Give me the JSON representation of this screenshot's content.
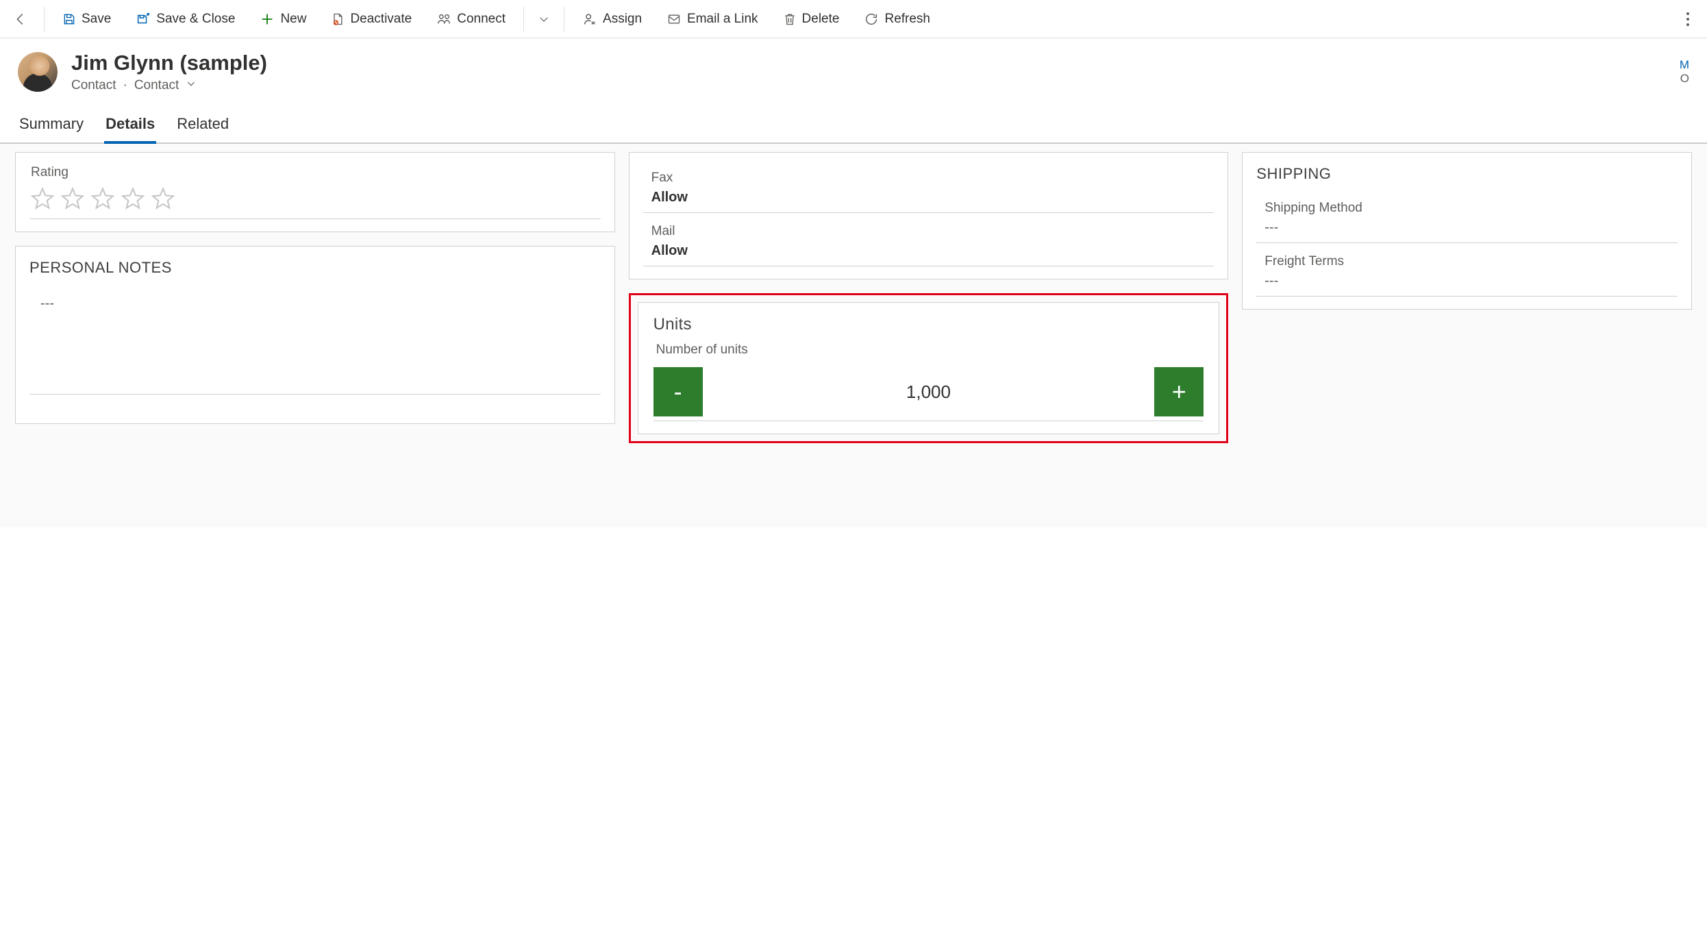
{
  "commands": {
    "save": "Save",
    "save_close": "Save & Close",
    "new": "New",
    "deactivate": "Deactivate",
    "connect": "Connect",
    "assign": "Assign",
    "email_link": "Email a Link",
    "delete": "Delete",
    "refresh": "Refresh"
  },
  "record": {
    "title": "Jim Glynn (sample)",
    "entity": "Contact",
    "form": "Contact",
    "right_top": "M",
    "right_bot": "O"
  },
  "tabs": {
    "summary": "Summary",
    "details": "Details",
    "related": "Related"
  },
  "left_col": {
    "rating_label": "Rating",
    "notes_title": "PERSONAL NOTES",
    "notes_value": "---"
  },
  "mid_col": {
    "fax_label": "Fax",
    "fax_value": "Allow",
    "mail_label": "Mail",
    "mail_value": "Allow",
    "units_title": "Units",
    "units_label": "Number of units",
    "units_value": "1,000"
  },
  "right_col": {
    "shipping_title": "SHIPPING",
    "ship_method_label": "Shipping Method",
    "ship_method_value": "---",
    "freight_label": "Freight Terms",
    "freight_value": "---"
  }
}
